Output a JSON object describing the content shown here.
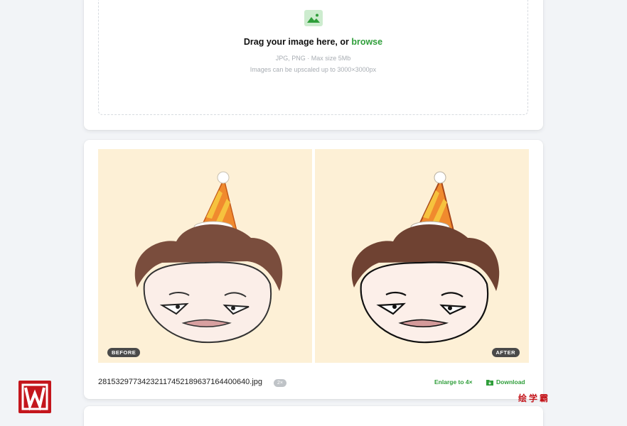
{
  "upload": {
    "title_prefix": "Drag your image here, or ",
    "browse_label": "browse",
    "formats": "JPG, PNG · Max size 5Mb",
    "limit": "Images can be upscaled up to 3000×3000px"
  },
  "result": {
    "before_label": "BEFORE",
    "after_label": "AFTER",
    "filename": "2815329773423211745218963716440064​0.jpg",
    "scale_chip": "2×",
    "enlarge_label": "Enlarge to 4×",
    "download_label": "Download"
  },
  "watermark": {
    "text": "绘学霸"
  },
  "colors": {
    "accent": "#2f9e3a",
    "background": "#f2f4f7",
    "image_bg": "#fdf0d6",
    "badge_bg": "#4a4a4a",
    "watermark_red": "#c4161c"
  },
  "icons": {
    "upload": "image-icon",
    "download": "folder-download-icon"
  }
}
